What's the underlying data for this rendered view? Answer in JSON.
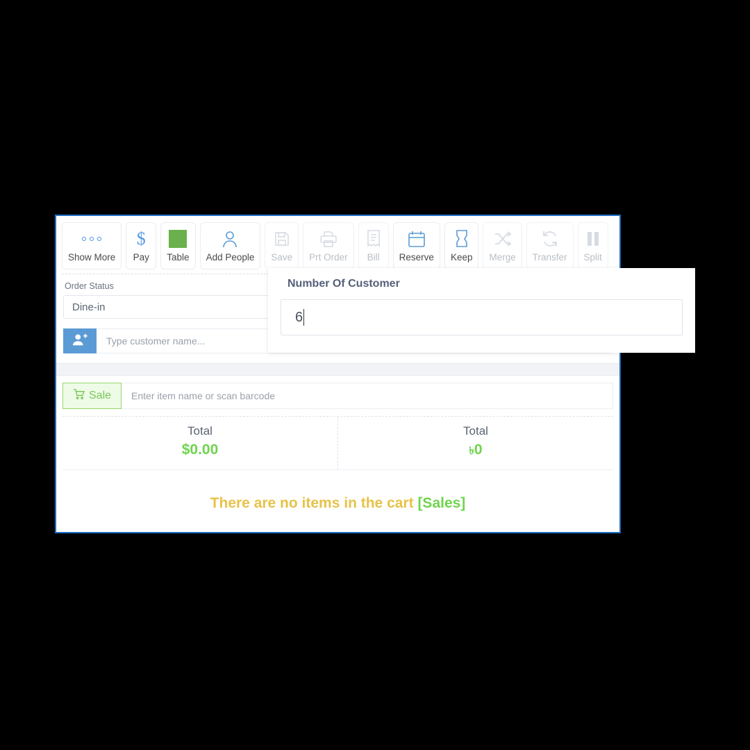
{
  "toolbar": {
    "buttons": [
      {
        "label": "Show More",
        "icon": "three-dots-icon",
        "state": "active"
      },
      {
        "label": "Pay",
        "icon": "dollar-sign-icon",
        "state": "active"
      },
      {
        "label": "Table",
        "icon": "table-square-icon",
        "state": "active"
      },
      {
        "label": "Add People",
        "icon": "person-icon",
        "state": "active"
      },
      {
        "label": "Save",
        "icon": "floppy-disk-icon",
        "state": "disabled"
      },
      {
        "label": "Prt Order",
        "icon": "printer-icon",
        "state": "disabled"
      },
      {
        "label": "Bill",
        "icon": "receipt-icon",
        "state": "disabled"
      },
      {
        "label": "Reserve",
        "icon": "calendar-icon",
        "state": "active"
      },
      {
        "label": "Keep",
        "icon": "bookmark-ticket-icon",
        "state": "active"
      },
      {
        "label": "Merge",
        "icon": "shuffle-arrows-icon",
        "state": "disabled"
      },
      {
        "label": "Transfer",
        "icon": "refresh-arrows-icon",
        "state": "disabled"
      },
      {
        "label": "Split",
        "icon": "split-bars-icon",
        "state": "disabled"
      }
    ]
  },
  "order": {
    "status_label": "Order Status",
    "status_value": "Dine-in",
    "customer_placeholder": "Type customer name..."
  },
  "sale": {
    "tag_label": "Sale",
    "tag_icon": "shopping-cart-icon",
    "search_placeholder": "Enter item name or scan barcode"
  },
  "totals": [
    {
      "title": "Total",
      "value": "$0.00",
      "currency_symbol": "",
      "amount": ""
    },
    {
      "title": "Total",
      "value": "",
      "currency_symbol": "৳",
      "amount": "0"
    }
  ],
  "cart": {
    "empty_text": "There are no items in the cart ",
    "empty_tag": "[Sales]"
  },
  "modal": {
    "title": "Number Of Customer",
    "input_value": "6"
  },
  "colors": {
    "panel_border": "#1f6fc4",
    "accent_blue": "#5b9bd5",
    "green": "#6fd44f",
    "table_green": "#6ab04c",
    "amber": "#e8c248"
  }
}
